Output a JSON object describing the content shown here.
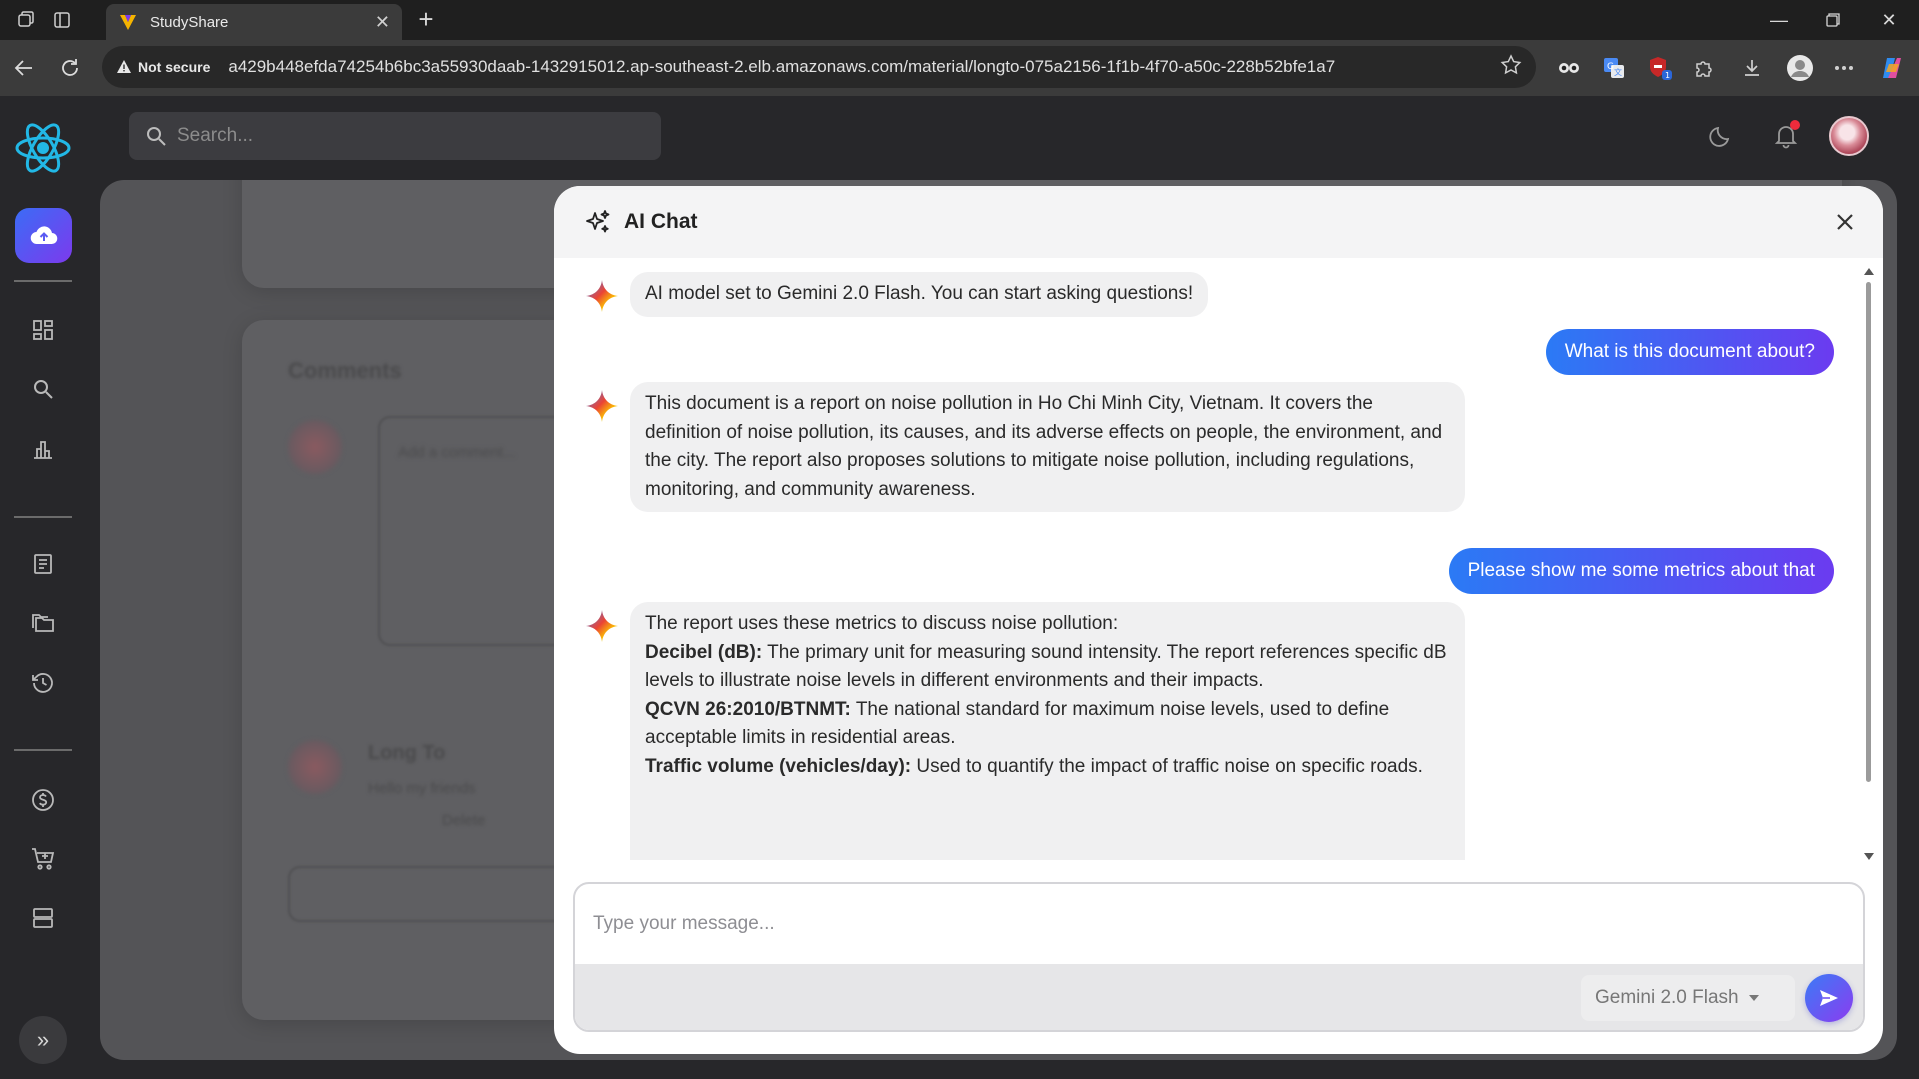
{
  "browser": {
    "tab_title": "StudyShare",
    "security_label": "Not secure",
    "url": "a429b448efda74254b6bc3a55930daab-1432915012.ap-southeast-2.elb.amazonaws.com/material/longto-075a2156-1f1b-4f70-a50c-228b52bfe1a7",
    "extension_badge": "1"
  },
  "app": {
    "search_placeholder": "Search...",
    "background": {
      "comments_title": "Comments",
      "comment_placeholder": "Add a comment...",
      "commenter_name": "Long To",
      "comment_text": "Hello my friends",
      "delete_label": "Delete"
    }
  },
  "chat": {
    "title": "AI Chat",
    "messages": [
      {
        "role": "bot",
        "text": "AI model set to Gemini 2.0 Flash. You can start asking questions!"
      },
      {
        "role": "user",
        "text": "What is this document about?"
      },
      {
        "role": "bot",
        "text": "This document is a report on noise pollution in Ho Chi Minh City, Vietnam. It covers the definition of noise pollution, its causes, and its adverse effects on people, the environment, and the city. The report also proposes solutions to mitigate noise pollution, including regulations, monitoring, and community awareness."
      },
      {
        "role": "user",
        "text": "Please show me some metrics about that"
      },
      {
        "role": "bot",
        "intro": "The report uses these metrics to discuss noise pollution:",
        "items": [
          {
            "term": "Decibel (dB):",
            "desc": " The primary unit for measuring sound intensity. The report references specific dB levels to illustrate noise levels in different environments and their impacts."
          },
          {
            "term": "QCVN 26:2010/BTNMT:",
            "desc": " The national standard for maximum noise levels, used to define acceptable limits in residential areas."
          },
          {
            "term": "Traffic volume (vehicles/day):",
            "desc": " Used to quantify the impact of traffic noise on specific roads."
          }
        ]
      }
    ],
    "input_placeholder": "Type your message...",
    "model_selected": "Gemini 2.0 Flash"
  }
}
